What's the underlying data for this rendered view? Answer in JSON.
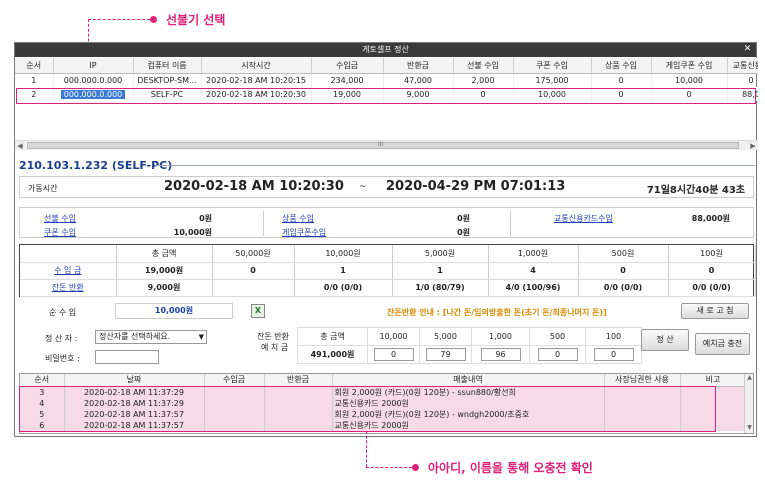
{
  "annotations": {
    "top": "선불기 선택",
    "bottom": "아아디, 이름을 통해 오충전 확인"
  },
  "window": {
    "title": "게토셀프 정산",
    "close_icon": "close-icon"
  },
  "pc_grid": {
    "columns": [
      "순서",
      "IP",
      "컴퓨터 이름",
      "시작시간",
      "수입금",
      "반환금",
      "선불 수입",
      "쿠폰 수입",
      "상품 수입",
      "게임쿠폰 수입",
      "교통신용카"
    ],
    "rows": [
      [
        "1",
        "000.000.0.000",
        "DESKTOP-SM...",
        "2020-02-18 AM 10:20:15",
        "234,000",
        "47,000",
        "2,000",
        "175,000",
        "0",
        "10,000",
        "0"
      ],
      [
        "2",
        "000.000.0.000",
        "SELF-PC",
        "2020-02-18 AM 10:20:30",
        "19,000",
        "9,000",
        "0",
        "10,000",
        "0",
        "0",
        "88,0"
      ]
    ],
    "scroll_label": "III"
  },
  "pc_title": "210.103.1.232 (SELF-PC)",
  "usage": {
    "label": "가동시간",
    "start": "2020-02-18 AM 10:20:30",
    "tilde": "~",
    "end": "2020-04-29 PM 07:01:13",
    "duration": "71일8시간40분 43초"
  },
  "summary": {
    "prepaid_label": "선불 수입",
    "prepaid_value": "0원",
    "coupon_label": "쿠폰 수입",
    "coupon_value": "10,000원",
    "goods_label": "상품 수입",
    "goods_value": "0원",
    "gamecoupon_label": "게임쿠폰수입",
    "gamecoupon_value": "0원",
    "transit_label": "교통신용카드수입",
    "transit_value": "88,000원"
  },
  "denominations": {
    "headers": [
      "",
      "총 금액",
      "50,000원",
      "10,000원",
      "5,000원",
      "1,000원",
      "500원",
      "100원"
    ],
    "income": [
      "수 입 금",
      "19,000원",
      "0",
      "1",
      "1",
      "4",
      "0",
      "0"
    ],
    "change": [
      "잔돈 반환",
      "9,000원",
      "",
      "0/0 (0/0)",
      "1/0 (80/79)",
      "4/0 (100/96)",
      "0/0 (0/0)",
      "0/0 (0/0)"
    ]
  },
  "net": {
    "label": "순 수 입",
    "value": "10,000원",
    "excel_icon": "excel-icon",
    "notice": "잔돈반환 안내 : [나간 돈/임의방출한 돈(초기 돈/최종나머지 돈)]",
    "refresh_button": "새 로 고 침"
  },
  "settlement": {
    "settler_label": "정 산 자 :",
    "settler_select": "정산자를 선택하세요.",
    "password_label": "비밀번호 :",
    "deposit_label_1": "잔돈 반환",
    "deposit_label_2": "예 치 금",
    "headers": [
      "총 금액",
      "10,000",
      "5,000",
      "1,000",
      "500",
      "100"
    ],
    "total": "491,000원",
    "inputs": [
      "0",
      "79",
      "96",
      "0",
      "0"
    ],
    "settle_button": "정 산",
    "deposit_button": "예치금 충전"
  },
  "log": {
    "columns": [
      "순서",
      "날짜",
      "수입금",
      "반환금",
      "매출내역",
      "사장님권한 사용",
      "비고"
    ],
    "rows": [
      [
        "3",
        "2020-02-18 AM 11:37:29",
        "",
        "",
        "회원 2,000원 (카드)(0원 120분) - ssun880/황선희",
        "",
        ""
      ],
      [
        "4",
        "2020-02-18 AM 11:37:29",
        "",
        "",
        "교통신용카드 2000원",
        "",
        ""
      ],
      [
        "5",
        "2020-02-18 AM 11:37:57",
        "",
        "",
        "회원 2,000원 (카드)(0원 120분) - wndgh2000/조중호",
        "",
        ""
      ],
      [
        "6",
        "2020-02-18 AM 11:37:57",
        "",
        "",
        "교통신용카드 2000원",
        "",
        ""
      ]
    ]
  }
}
